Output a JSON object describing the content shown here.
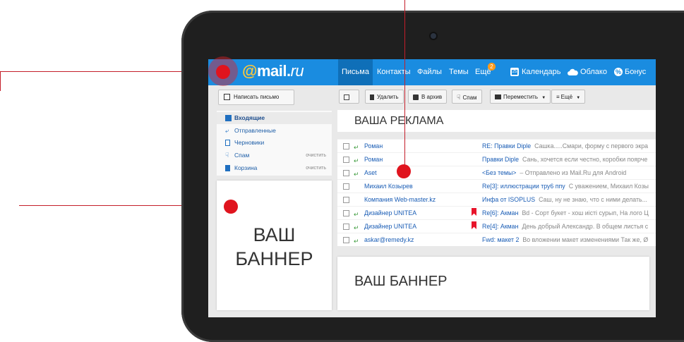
{
  "app": {
    "logo_at": "@",
    "logo_mail": "mail",
    "logo_dot": ".",
    "logo_ru": "ru"
  },
  "nav": {
    "items": [
      {
        "label": "Письма",
        "active": true
      },
      {
        "label": "Контакты"
      },
      {
        "label": "Файлы"
      },
      {
        "label": "Темы"
      },
      {
        "label": "Ещё"
      }
    ],
    "more_badge": "2",
    "right": [
      {
        "label": "Календарь",
        "icon": "calendar-icon"
      },
      {
        "label": "Облако",
        "icon": "cloud-icon"
      },
      {
        "label": "Бонус",
        "icon": "bonus-icon"
      }
    ]
  },
  "compose_label": "Написать письмо",
  "folders": [
    {
      "label": "Входящие",
      "icon": "inbox-icon",
      "active": true
    },
    {
      "label": "Отправленные",
      "icon": "sent-icon"
    },
    {
      "label": "Черновики",
      "icon": "drafts-icon"
    },
    {
      "label": "Спам",
      "icon": "spam-icon",
      "clear": "очистить"
    },
    {
      "label": "Корзина",
      "icon": "trash-icon",
      "clear": "очистить"
    }
  ],
  "toolbar": {
    "delete": "Удалить",
    "archive": "В архив",
    "spam": "Спам",
    "move": "Переместить",
    "more": "Ещё"
  },
  "ad_top": "ВАША РЕКЛАМА",
  "banner_left_line1": "ВАШ",
  "banner_left_line2": "БАННЕР",
  "banner_bottom": "ВАШ БАННЕР",
  "messages": [
    {
      "from": "Роман",
      "subject": "RE: Правки Diple",
      "snippet": "Сашка.....Смари, форму с первого экра",
      "replied": true
    },
    {
      "from": "Роман",
      "subject": "Правки Diple",
      "snippet": "Сань, хочется если честно, коробки поярче",
      "replied": true
    },
    {
      "from": "Aset",
      "subject": "<Без темы>",
      "snippet": "– Отправлено из Mail.Ru для Android",
      "replied": true
    },
    {
      "from": "Михаил Козырев",
      "subject": "Re[3]: иллюстрации тру6 ппу",
      "snippet": "С уважением, Михаил Козы"
    },
    {
      "from": "Компания Web-master.kz",
      "subject": "Инфа от ISOPLUS",
      "snippet": "Саш, ну не знаю, что с ними делать..."
    },
    {
      "from": "Дизайнер UNITEA",
      "subject": "Re[6]: Акман",
      "snippet": "Bd - Сорт букет - хош иiстi сурып, На лого Ц",
      "replied": true,
      "flag": true
    },
    {
      "from": "Дизайнер UNITEA",
      "subject": "Re[4]: Акман",
      "snippet": "День добрый Александр. В общем листья с",
      "replied": true,
      "flag": true
    },
    {
      "from": "askar@remedy.kz",
      "subject": "Fwd: макет 2",
      "snippet": "Во вложении макет изменениями Так же, Ø",
      "replied": true
    }
  ],
  "colors": {
    "topbar": "#1a8ce0",
    "callout": "#e0141e",
    "link": "#1a5db5"
  }
}
